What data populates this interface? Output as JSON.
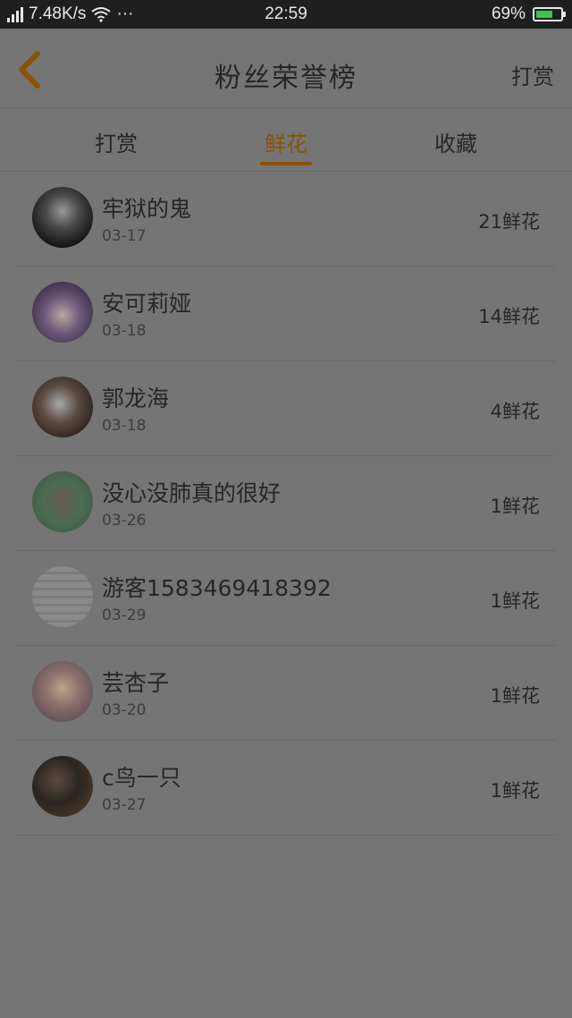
{
  "status_bar": {
    "network_type": "2G",
    "speed": "7.48K/s",
    "more": "···",
    "time": "22:59",
    "battery": "69%",
    "battery_level": 0.69,
    "colors": {
      "battery_fill": "#34c94a"
    }
  },
  "header": {
    "title": "粉丝荣誉榜",
    "right_action": "打赏",
    "back_icon": "chevron-left-icon",
    "accent": "#8a5300"
  },
  "tabs": [
    {
      "label": "打赏",
      "active": false
    },
    {
      "label": "鲜花",
      "active": true
    },
    {
      "label": "收藏",
      "active": false
    }
  ],
  "fans": [
    {
      "name": "牢狱的鬼",
      "date": "03-17",
      "count": "21鲜花"
    },
    {
      "name": "安可莉娅",
      "date": "03-18",
      "count": "14鲜花"
    },
    {
      "name": "郭龙海",
      "date": "03-18",
      "count": "4鲜花"
    },
    {
      "name": "没心没肺真的很好",
      "date": "03-26",
      "count": "1鲜花"
    },
    {
      "name": "游客1583469418392",
      "date": "03-29",
      "count": "1鲜花"
    },
    {
      "name": "芸杏子",
      "date": "03-20",
      "count": "1鲜花"
    },
    {
      "name": "c鸟一只",
      "date": "03-27",
      "count": "1鲜花"
    }
  ]
}
